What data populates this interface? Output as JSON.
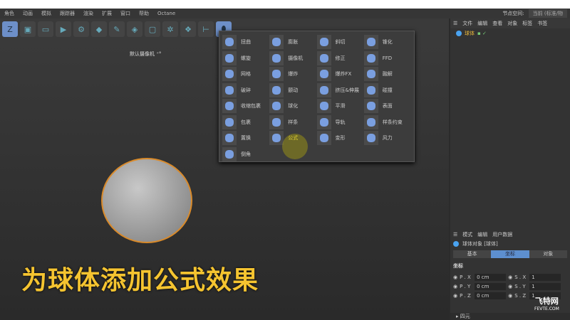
{
  "menu": [
    "角色",
    "动画",
    "模拟",
    "跟踪器",
    "渲染",
    "扩展",
    "窗口",
    "帮助",
    "Octane"
  ],
  "node_space": {
    "label": "节点空间:",
    "value": "当前 (标准/物"
  },
  "viewport": {
    "camera_label": "默认摄像机 ⁺°",
    "caption": "为球体添加公式效果"
  },
  "deformers": [
    [
      "扭曲",
      "螺旋",
      "网格",
      "破碎",
      "收缩包裹",
      "包裹",
      "置换",
      "倒角"
    ],
    [
      "膨胀",
      "摄像机",
      "爆炸",
      "颤动",
      "球化",
      "样条",
      "公式"
    ],
    [
      "斜切",
      "修正",
      "爆炸FX",
      "挤压&伸展",
      "平滑",
      "导轨",
      "变形"
    ],
    [
      "锥化",
      "FFD",
      "融解",
      "碰撞",
      "表面",
      "样条约束",
      "风力"
    ]
  ],
  "object_manager": {
    "menu": [
      "文件",
      "编辑",
      "查看",
      "对象",
      "标签",
      "书签"
    ],
    "object": "球体"
  },
  "attributes": {
    "menu": [
      "模式",
      "编辑",
      "用户数据"
    ],
    "title": "球体对象 [球体]",
    "tabs": [
      "基本",
      "坐标",
      "对象"
    ],
    "section": "坐标",
    "rows": [
      {
        "p": "P . X",
        "pv": "0 cm",
        "s": "S . X",
        "sv": "1"
      },
      {
        "p": "P . Y",
        "pv": "0 cm",
        "s": "S . Y",
        "sv": "1"
      },
      {
        "p": "P . Z",
        "pv": "0 cm",
        "s": "S . Z",
        "sv": "1"
      }
    ],
    "footer": "▸ 四元"
  },
  "watermark": {
    "logo": "飞特网",
    "url": "FEVTE.COM"
  }
}
